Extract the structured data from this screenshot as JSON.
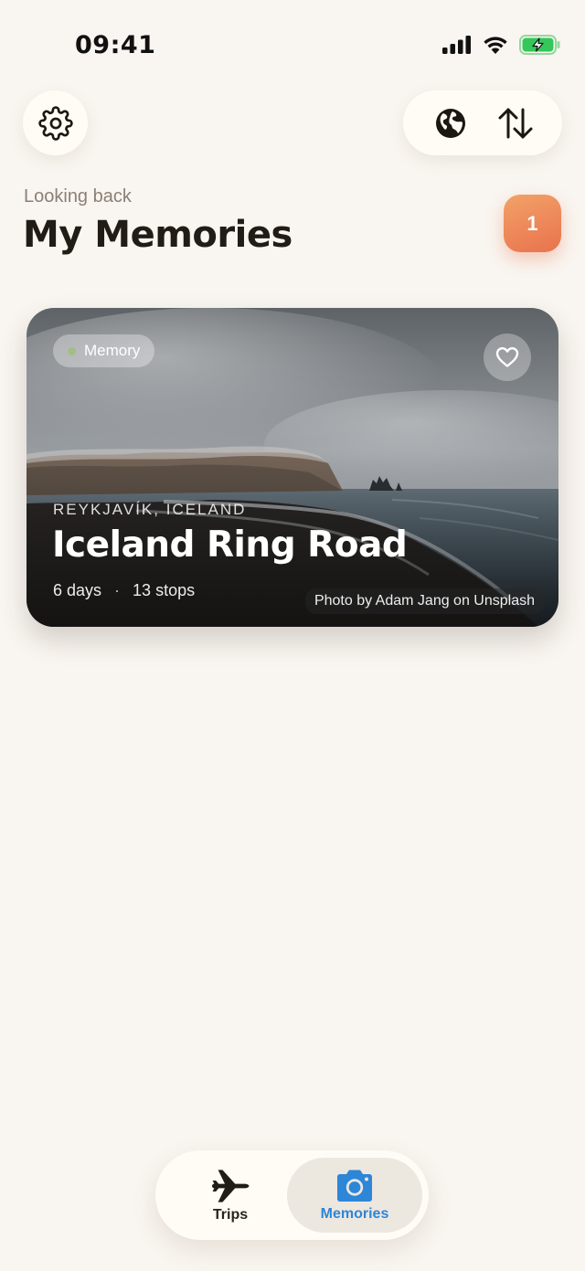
{
  "status_bar": {
    "time": "09:41"
  },
  "header": {
    "subtitle": "Looking back",
    "title": "My Memories",
    "count": "1"
  },
  "memories": [
    {
      "tag": "Memory",
      "location": "REYKJAVÍK, ICELAND",
      "title": "Iceland Ring Road",
      "days": "6 days",
      "separator": "·",
      "stops": "13 stops",
      "photo_credit": "Photo by Adam Jang on Unsplash"
    }
  ],
  "tabs": [
    {
      "label": "Trips",
      "icon": "airplane-icon",
      "active": false
    },
    {
      "label": "Memories",
      "icon": "camera-icon",
      "active": true
    }
  ],
  "colors": {
    "background": "#f9f5f0",
    "accent": "#2d86d8",
    "badge": "#e9724d",
    "tag_dot": "#9fbf84"
  }
}
